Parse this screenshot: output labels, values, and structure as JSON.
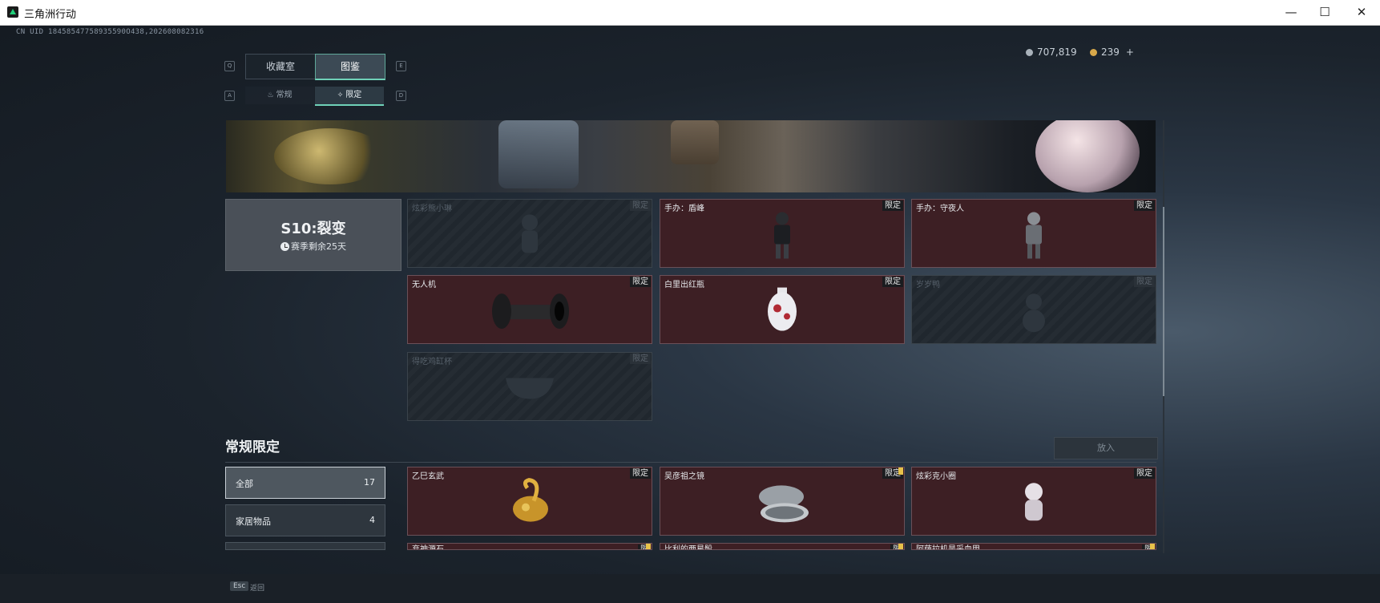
{
  "window": {
    "title": "三角洲行动"
  },
  "uid": "CN UID 18458547758935590O438,202608082316",
  "nav": {
    "key_left": "Q",
    "key_right": "E",
    "tabs": [
      {
        "label": "收藏室"
      },
      {
        "label": "图鉴"
      }
    ],
    "sub_key_left": "A",
    "sub_key_right": "D",
    "sub_tabs": [
      {
        "label": "常规"
      },
      {
        "label": "限定"
      }
    ]
  },
  "currency": [
    {
      "amount": "707,819",
      "color": "#a9b2ba"
    },
    {
      "amount": "239",
      "color": "#d8a84a",
      "plus": "+"
    }
  ],
  "season": {
    "title": "S10:裂变",
    "remaining": "赛季剩余25天"
  },
  "season_items": [
    {
      "name": "炫彩熊小琳",
      "tag": "限定",
      "owned": false
    },
    {
      "name": "手办：盾峰",
      "tag": "限定",
      "owned": true
    },
    {
      "name": "手办：守夜人",
      "tag": "限定",
      "owned": true
    },
    {
      "name": "无人机",
      "tag": "限定",
      "owned": true
    },
    {
      "name": "白里出红瓶",
      "tag": "限定",
      "owned": true
    },
    {
      "name": "岁岁鸭",
      "tag": "限定",
      "owned": false
    },
    {
      "name": "得吃鸡缸杯",
      "tag": "限定",
      "owned": false
    }
  ],
  "section": {
    "title": "常规限定",
    "put_button": "放入"
  },
  "filters": [
    {
      "label": "全部",
      "count": "17"
    },
    {
      "label": "家居物品",
      "count": "4"
    },
    {
      "label": "",
      "count": ""
    }
  ],
  "regular_items": [
    {
      "name": "乙巳玄武",
      "tag": "限定"
    },
    {
      "name": "吴彦祖之镜",
      "tag": "限定"
    },
    {
      "name": "炫彩克小圈",
      "tag": "限定"
    },
    {
      "name": "弃神源石",
      "tag": "限"
    },
    {
      "name": "比利的两星骰",
      "tag": "限"
    },
    {
      "name": "阿萨拉机是采血甲",
      "tag": "限"
    }
  ],
  "footer": {
    "key": "Esc",
    "label": "返回"
  }
}
